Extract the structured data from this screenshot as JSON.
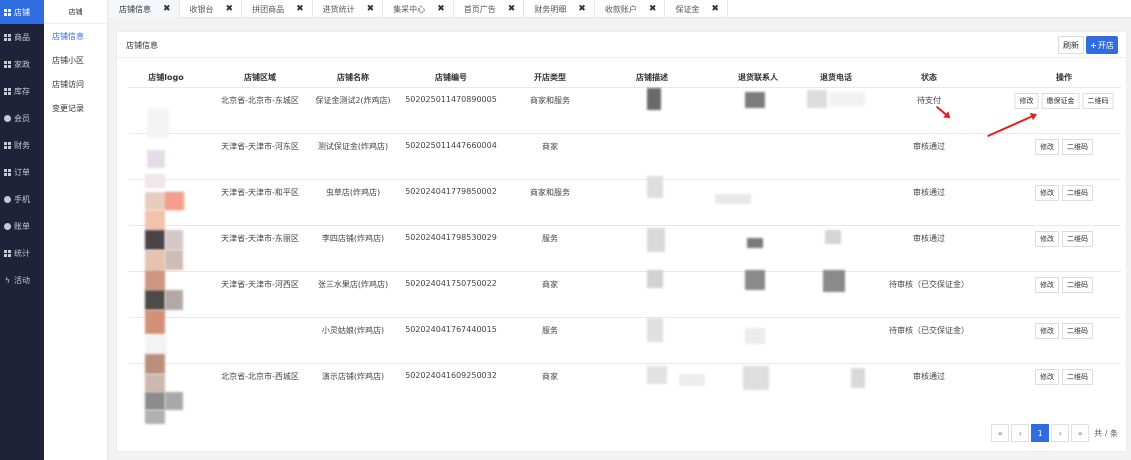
{
  "rail": {
    "items": [
      {
        "label": "店铺",
        "icon": "grid-icon",
        "active": true
      },
      {
        "label": "商品",
        "icon": "grid-icon"
      },
      {
        "label": "家政",
        "icon": "grid-icon"
      },
      {
        "label": "库存",
        "icon": "grid-icon"
      },
      {
        "label": "会员",
        "icon": "user-icon"
      },
      {
        "label": "财务",
        "icon": "grid-icon"
      },
      {
        "label": "订单",
        "icon": "grid-icon"
      },
      {
        "label": "手机",
        "icon": "phone-icon"
      },
      {
        "label": "账单",
        "icon": "circle-icon"
      },
      {
        "label": "统计",
        "icon": "grid-icon"
      },
      {
        "label": "活动",
        "icon": "bolt-icon"
      }
    ]
  },
  "subnav": {
    "header": "店铺",
    "items": [
      {
        "label": "店铺信息",
        "active": true
      },
      {
        "label": "店铺小区"
      },
      {
        "label": "店铺访问"
      },
      {
        "label": "变更记录"
      }
    ]
  },
  "tabs": [
    {
      "label": "店铺信息",
      "active": true
    },
    {
      "label": "收银台"
    },
    {
      "label": "拼团商品"
    },
    {
      "label": "进货统计"
    },
    {
      "label": "集采中心"
    },
    {
      "label": "首页广告"
    },
    {
      "label": "财务明细"
    },
    {
      "label": "收款账户"
    },
    {
      "label": "保证金"
    }
  ],
  "card": {
    "title": "店铺信息",
    "refresh_label": "刷新",
    "open_label": "开店"
  },
  "table": {
    "headers": [
      "店铺logo",
      "店铺区域",
      "店铺名称",
      "店铺编号",
      "开店类型",
      "店铺描述",
      "退货联系人",
      "退货电话",
      "状态",
      "操作"
    ],
    "rows": [
      {
        "area": "北京省-北京市-东城区",
        "name": "保证金测试2(炸鸡店)",
        "code": "502025011470890005",
        "type": "商家和服务",
        "status": "待支付",
        "ops": [
          "修改",
          "缴保证金",
          "二维码"
        ]
      },
      {
        "area": "天津省-天津市-河东区",
        "name": "测试保证金(炸鸡店)",
        "code": "502025011447660004",
        "type": "商家",
        "status": "审核通过",
        "ops": [
          "修改",
          "二维码"
        ]
      },
      {
        "area": "天津省-天津市-和平区",
        "name": "虫草店(炸鸡店)",
        "code": "502024041779850002",
        "type": "商家和服务",
        "status": "审核通过",
        "ops": [
          "修改",
          "二维码"
        ]
      },
      {
        "area": "天津省-天津市-东丽区",
        "name": "李四店铺(炸鸡店)",
        "code": "502024041798530029",
        "type": "服务",
        "status": "审核通过",
        "ops": [
          "修改",
          "二维码"
        ]
      },
      {
        "area": "天津省-天津市-河西区",
        "name": "张三水果店(炸鸡店)",
        "code": "502024041750750022",
        "type": "商家",
        "status": "待审核（已交保证金）",
        "ops": [
          "修改",
          "二维码"
        ]
      },
      {
        "area": "",
        "name": "小灵姑娘(炸鸡店)",
        "code": "502024041767440015",
        "type": "服务",
        "status": "待审核（已交保证金）",
        "ops": [
          "修改",
          "二维码"
        ]
      },
      {
        "area": "北京省-北京市-西城区",
        "name": "演示店铺(炸鸡店)",
        "code": "502024041609250032",
        "type": "商家",
        "status": "审核通过",
        "ops": [
          "修改",
          "二维码"
        ]
      }
    ]
  },
  "pagination": {
    "first": "«",
    "prev": "‹",
    "current": "1",
    "next": "›",
    "last": "»",
    "summary": "共 / 条"
  },
  "colors": {
    "accent": "#2f6ce0",
    "rail": "#1f2239",
    "annotation": "#e02020"
  }
}
